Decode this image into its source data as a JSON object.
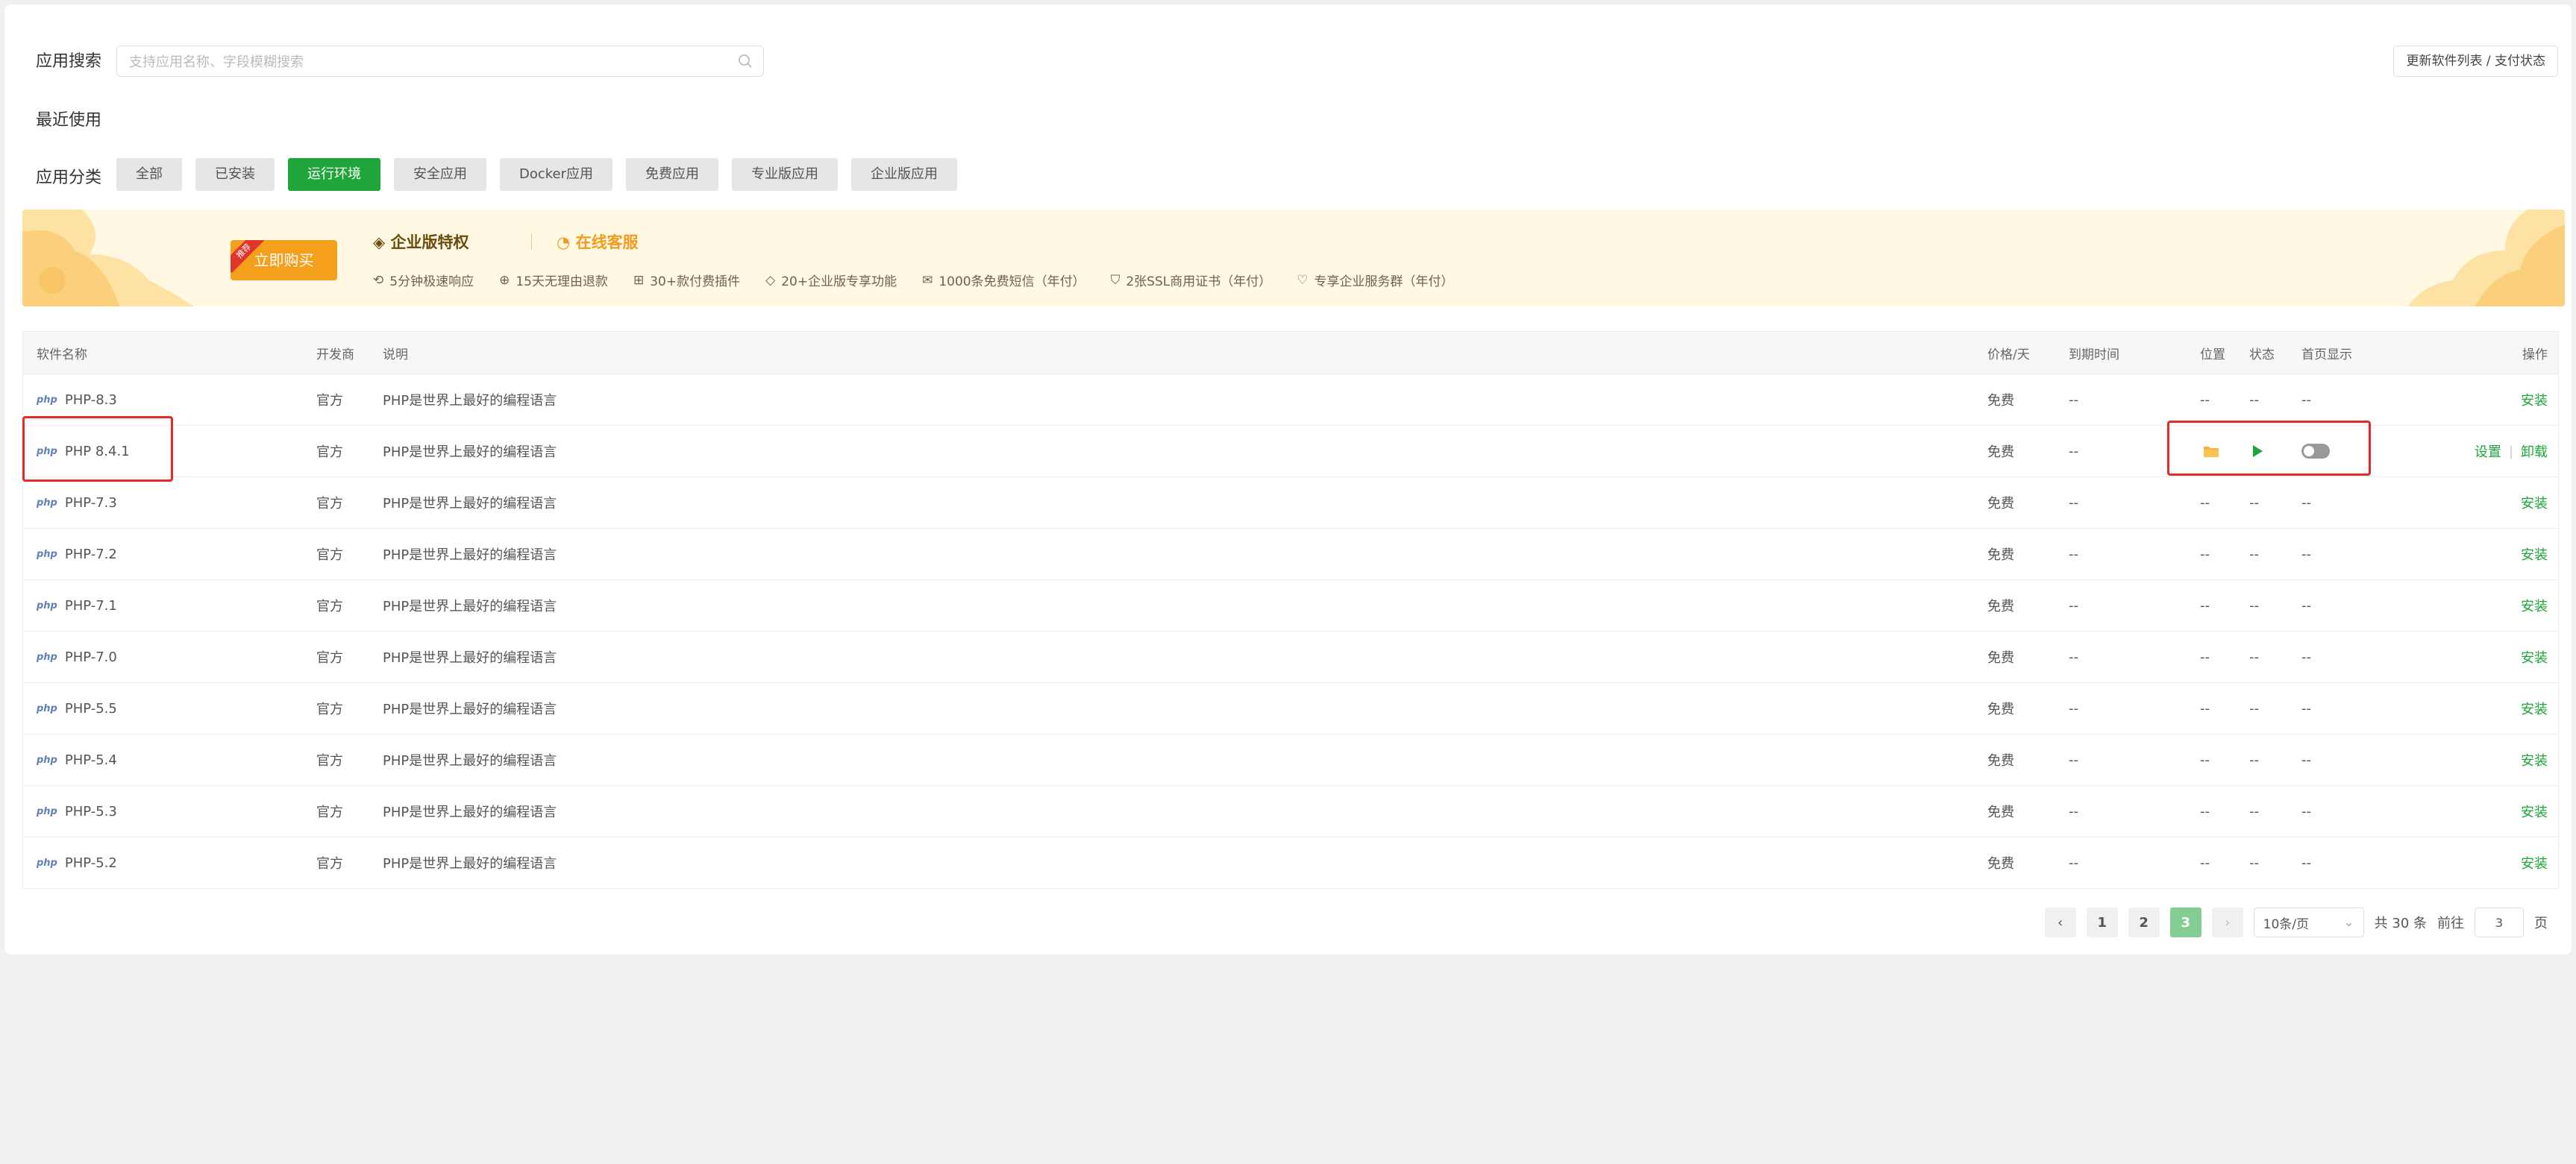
{
  "search": {
    "label": "应用搜索",
    "placeholder": "支持应用名称、字段模糊搜索",
    "update_button": "更新软件列表 / 支付状态"
  },
  "recent": {
    "label": "最近使用"
  },
  "categories": {
    "label": "应用分类",
    "items": [
      "全部",
      "已安装",
      "运行环境",
      "安全应用",
      "Docker应用",
      "免费应用",
      "专业版应用",
      "企业版应用"
    ],
    "active": "运行环境"
  },
  "banner": {
    "buy_button": "立即购买",
    "buy_ribbon": "推荐",
    "title": "企业版特权",
    "service": "在线客服",
    "perks": [
      "5分钟极速响应",
      "15天无理由退款",
      "30+款付费插件",
      "20+企业版专享功能",
      "1000条免费短信（年付）",
      "2张SSL商用证书（年付）",
      "专享企业服务群（年付）"
    ]
  },
  "table": {
    "headers": {
      "name": "软件名称",
      "developer": "开发商",
      "description": "说明",
      "price": "价格/天",
      "expire": "到期时间",
      "position": "位置",
      "status": "状态",
      "homepage": "首页显示",
      "action": "操作"
    },
    "rows": [
      {
        "name": "PHP-8.3",
        "developer": "官方",
        "description": "PHP是世界上最好的编程语言",
        "price": "免费",
        "expire": "--",
        "position": "--",
        "status": "--",
        "homepage": "--",
        "action": "安装"
      },
      {
        "name": "PHP 8.4.1",
        "developer": "官方",
        "description": "PHP是世界上最好的编程语言",
        "price": "免费",
        "expire": "--",
        "action_settings": "设置",
        "action_uninstall": "卸载",
        "homepage_on": false
      },
      {
        "name": "PHP-7.3",
        "developer": "官方",
        "description": "PHP是世界上最好的编程语言",
        "price": "免费",
        "expire": "--",
        "position": "--",
        "status": "--",
        "homepage": "--",
        "action": "安装"
      },
      {
        "name": "PHP-7.2",
        "developer": "官方",
        "description": "PHP是世界上最好的编程语言",
        "price": "免费",
        "expire": "--",
        "position": "--",
        "status": "--",
        "homepage": "--",
        "action": "安装"
      },
      {
        "name": "PHP-7.1",
        "developer": "官方",
        "description": "PHP是世界上最好的编程语言",
        "price": "免费",
        "expire": "--",
        "position": "--",
        "status": "--",
        "homepage": "--",
        "action": "安装"
      },
      {
        "name": "PHP-7.0",
        "developer": "官方",
        "description": "PHP是世界上最好的编程语言",
        "price": "免费",
        "expire": "--",
        "position": "--",
        "status": "--",
        "homepage": "--",
        "action": "安装"
      },
      {
        "name": "PHP-5.5",
        "developer": "官方",
        "description": "PHP是世界上最好的编程语言",
        "price": "免费",
        "expire": "--",
        "position": "--",
        "status": "--",
        "homepage": "--",
        "action": "安装"
      },
      {
        "name": "PHP-5.4",
        "developer": "官方",
        "description": "PHP是世界上最好的编程语言",
        "price": "免费",
        "expire": "--",
        "position": "--",
        "status": "--",
        "homepage": "--",
        "action": "安装"
      },
      {
        "name": "PHP-5.3",
        "developer": "官方",
        "description": "PHP是世界上最好的编程语言",
        "price": "免费",
        "expire": "--",
        "position": "--",
        "status": "--",
        "homepage": "--",
        "action": "安装"
      },
      {
        "name": "PHP-5.2",
        "developer": "官方",
        "description": "PHP是世界上最好的编程语言",
        "price": "免费",
        "expire": "--",
        "position": "--",
        "status": "--",
        "homepage": "--",
        "action": "安装"
      }
    ],
    "php_logo_text": "php"
  },
  "pagination": {
    "pages": [
      "1",
      "2",
      "3"
    ],
    "current": "3",
    "page_size": "10条/页",
    "total": "共 30 条",
    "goto_label": "前往",
    "goto_value": "3",
    "page_unit": "页"
  },
  "colors": {
    "accent": "#20a53a",
    "banner_bg": "#fff8e2",
    "buy": "#f5a01c",
    "highlight": "#e12b2b"
  }
}
